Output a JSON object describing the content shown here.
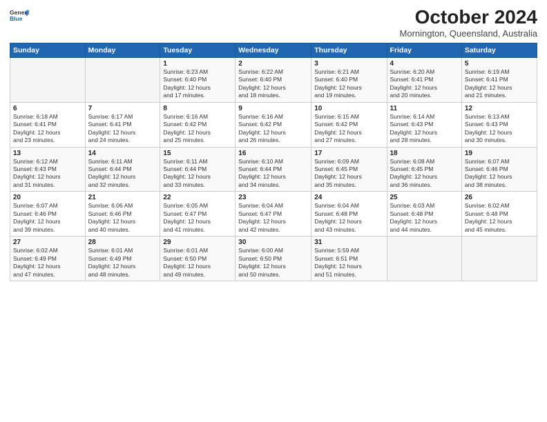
{
  "logo": {
    "line1": "General",
    "line2": "Blue"
  },
  "title": "October 2024",
  "location": "Mornington, Queensland, Australia",
  "days_header": [
    "Sunday",
    "Monday",
    "Tuesday",
    "Wednesday",
    "Thursday",
    "Friday",
    "Saturday"
  ],
  "weeks": [
    [
      {
        "num": "",
        "info": ""
      },
      {
        "num": "",
        "info": ""
      },
      {
        "num": "1",
        "info": "Sunrise: 6:23 AM\nSunset: 6:40 PM\nDaylight: 12 hours\nand 17 minutes."
      },
      {
        "num": "2",
        "info": "Sunrise: 6:22 AM\nSunset: 6:40 PM\nDaylight: 12 hours\nand 18 minutes."
      },
      {
        "num": "3",
        "info": "Sunrise: 6:21 AM\nSunset: 6:40 PM\nDaylight: 12 hours\nand 19 minutes."
      },
      {
        "num": "4",
        "info": "Sunrise: 6:20 AM\nSunset: 6:41 PM\nDaylight: 12 hours\nand 20 minutes."
      },
      {
        "num": "5",
        "info": "Sunrise: 6:19 AM\nSunset: 6:41 PM\nDaylight: 12 hours\nand 21 minutes."
      }
    ],
    [
      {
        "num": "6",
        "info": "Sunrise: 6:18 AM\nSunset: 6:41 PM\nDaylight: 12 hours\nand 23 minutes."
      },
      {
        "num": "7",
        "info": "Sunrise: 6:17 AM\nSunset: 6:41 PM\nDaylight: 12 hours\nand 24 minutes."
      },
      {
        "num": "8",
        "info": "Sunrise: 6:16 AM\nSunset: 6:42 PM\nDaylight: 12 hours\nand 25 minutes."
      },
      {
        "num": "9",
        "info": "Sunrise: 6:16 AM\nSunset: 6:42 PM\nDaylight: 12 hours\nand 26 minutes."
      },
      {
        "num": "10",
        "info": "Sunrise: 6:15 AM\nSunset: 6:42 PM\nDaylight: 12 hours\nand 27 minutes."
      },
      {
        "num": "11",
        "info": "Sunrise: 6:14 AM\nSunset: 6:43 PM\nDaylight: 12 hours\nand 28 minutes."
      },
      {
        "num": "12",
        "info": "Sunrise: 6:13 AM\nSunset: 6:43 PM\nDaylight: 12 hours\nand 30 minutes."
      }
    ],
    [
      {
        "num": "13",
        "info": "Sunrise: 6:12 AM\nSunset: 6:43 PM\nDaylight: 12 hours\nand 31 minutes."
      },
      {
        "num": "14",
        "info": "Sunrise: 6:11 AM\nSunset: 6:44 PM\nDaylight: 12 hours\nand 32 minutes."
      },
      {
        "num": "15",
        "info": "Sunrise: 6:11 AM\nSunset: 6:44 PM\nDaylight: 12 hours\nand 33 minutes."
      },
      {
        "num": "16",
        "info": "Sunrise: 6:10 AM\nSunset: 6:44 PM\nDaylight: 12 hours\nand 34 minutes."
      },
      {
        "num": "17",
        "info": "Sunrise: 6:09 AM\nSunset: 6:45 PM\nDaylight: 12 hours\nand 35 minutes."
      },
      {
        "num": "18",
        "info": "Sunrise: 6:08 AM\nSunset: 6:45 PM\nDaylight: 12 hours\nand 36 minutes."
      },
      {
        "num": "19",
        "info": "Sunrise: 6:07 AM\nSunset: 6:46 PM\nDaylight: 12 hours\nand 38 minutes."
      }
    ],
    [
      {
        "num": "20",
        "info": "Sunrise: 6:07 AM\nSunset: 6:46 PM\nDaylight: 12 hours\nand 39 minutes."
      },
      {
        "num": "21",
        "info": "Sunrise: 6:06 AM\nSunset: 6:46 PM\nDaylight: 12 hours\nand 40 minutes."
      },
      {
        "num": "22",
        "info": "Sunrise: 6:05 AM\nSunset: 6:47 PM\nDaylight: 12 hours\nand 41 minutes."
      },
      {
        "num": "23",
        "info": "Sunrise: 6:04 AM\nSunset: 6:47 PM\nDaylight: 12 hours\nand 42 minutes."
      },
      {
        "num": "24",
        "info": "Sunrise: 6:04 AM\nSunset: 6:48 PM\nDaylight: 12 hours\nand 43 minutes."
      },
      {
        "num": "25",
        "info": "Sunrise: 6:03 AM\nSunset: 6:48 PM\nDaylight: 12 hours\nand 44 minutes."
      },
      {
        "num": "26",
        "info": "Sunrise: 6:02 AM\nSunset: 6:48 PM\nDaylight: 12 hours\nand 45 minutes."
      }
    ],
    [
      {
        "num": "27",
        "info": "Sunrise: 6:02 AM\nSunset: 6:49 PM\nDaylight: 12 hours\nand 47 minutes."
      },
      {
        "num": "28",
        "info": "Sunrise: 6:01 AM\nSunset: 6:49 PM\nDaylight: 12 hours\nand 48 minutes."
      },
      {
        "num": "29",
        "info": "Sunrise: 6:01 AM\nSunset: 6:50 PM\nDaylight: 12 hours\nand 49 minutes."
      },
      {
        "num": "30",
        "info": "Sunrise: 6:00 AM\nSunset: 6:50 PM\nDaylight: 12 hours\nand 50 minutes."
      },
      {
        "num": "31",
        "info": "Sunrise: 5:59 AM\nSunset: 6:51 PM\nDaylight: 12 hours\nand 51 minutes."
      },
      {
        "num": "",
        "info": ""
      },
      {
        "num": "",
        "info": ""
      }
    ]
  ]
}
